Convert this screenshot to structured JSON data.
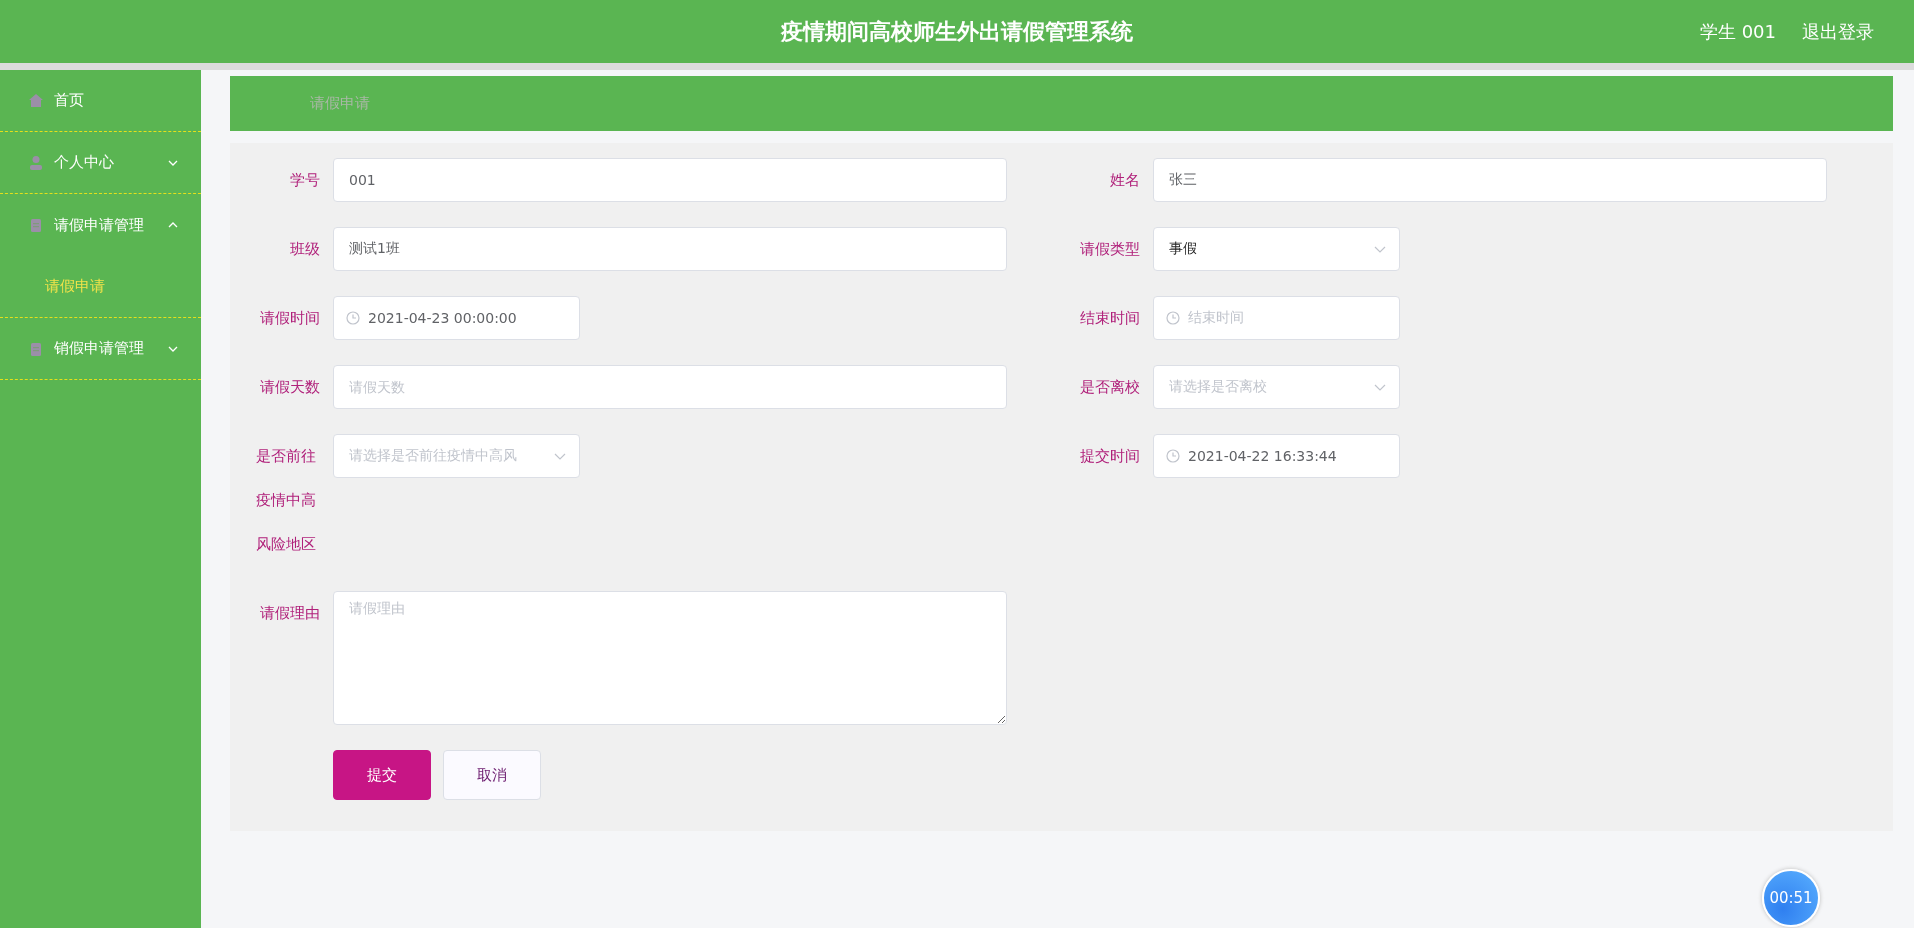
{
  "header": {
    "title": "疫情期间高校师生外出请假管理系统",
    "user": "学生 001",
    "logout": "退出登录"
  },
  "sidebar": {
    "items": [
      {
        "label": "首页",
        "selected": false
      },
      {
        "label": "个人中心",
        "expanded": false,
        "selected": false
      },
      {
        "label": "请假申请管理",
        "expanded": true,
        "selected": false,
        "children": [
          {
            "label": "请假申请",
            "selected": true
          }
        ]
      },
      {
        "label": "销假申请管理",
        "expanded": false,
        "selected": false
      }
    ]
  },
  "breadcrumb": "请假申请",
  "form": {
    "left": [
      {
        "label": "学号",
        "kind": "text",
        "value": "001"
      },
      {
        "label": "班级",
        "kind": "text",
        "value": "测试1班"
      },
      {
        "label": "请假时间",
        "kind": "date",
        "value": "2021-04-23 00:00:00"
      },
      {
        "label": "请假天数",
        "kind": "text",
        "placeholder": "请假天数"
      },
      {
        "label": "是否前往疫情中高风险地区",
        "kind": "select",
        "placeholder": "请选择是否前往疫情中高风"
      },
      {
        "label": "请假理由",
        "kind": "textarea",
        "placeholder": "请假理由"
      }
    ],
    "right": [
      {
        "label": "姓名",
        "kind": "text",
        "value": "张三"
      },
      {
        "label": "请假类型",
        "kind": "select",
        "value": "事假"
      },
      {
        "label": "结束时间",
        "kind": "date",
        "placeholder": "结束时间"
      },
      {
        "label": "是否离校",
        "kind": "select",
        "placeholder": "请选择是否离校"
      },
      {
        "label": "提交时间",
        "kind": "date",
        "value": "2021-04-22 16:33:44"
      }
    ],
    "buttons": [
      {
        "label": "提交",
        "kind": "primary"
      },
      {
        "label": "取消",
        "kind": "secondary"
      }
    ]
  },
  "timer": "00:51"
}
